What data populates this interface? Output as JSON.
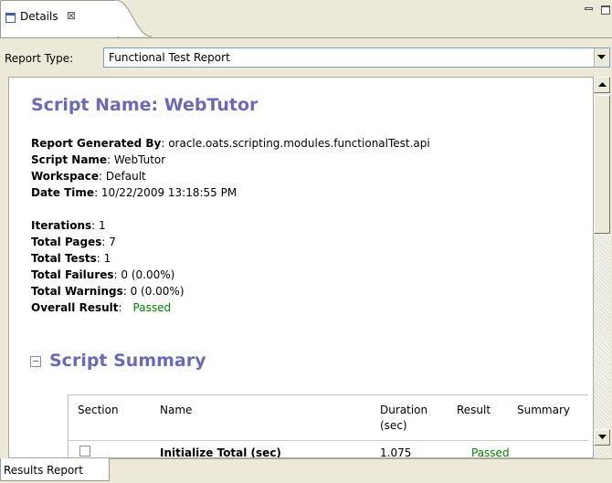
{
  "view_tab": {
    "label": "Details",
    "close_glyph": "⊠",
    "icon": "details-view-icon"
  },
  "window_controls": {
    "minimize": "minimize-icon",
    "maximize": "maximize-icon"
  },
  "report_type": {
    "label": "Report Type:",
    "value": "Functional Test Report"
  },
  "report": {
    "title": "Script Name: WebTutor",
    "generated_by": {
      "label": "Report Generated By",
      "value": ": oracle.oats.scripting.modules.functionalTest.api"
    },
    "script_name": {
      "label": "Script Name",
      "value": ": WebTutor"
    },
    "workspace": {
      "label": "Workspace",
      "value": ": Default"
    },
    "date_time": {
      "label": "Date Time",
      "value": ": 10/22/2009 13:18:55 PM"
    },
    "iterations": {
      "label": "Iterations",
      "value": ": 1"
    },
    "total_pages": {
      "label": "Total Pages",
      "value": ": 7"
    },
    "total_tests": {
      "label": "Total Tests",
      "value": ": 1"
    },
    "total_failures": {
      "label": "Total Failures",
      "value": ": 0 (0.00%)"
    },
    "total_warnings": {
      "label": "Total Warnings",
      "value": ": 0 (0.00%)"
    },
    "overall_result": {
      "label": "Overall Result",
      "colon": ":",
      "value": "Passed"
    },
    "summary_heading": "Script Summary",
    "table": {
      "headers": {
        "section": "Section",
        "name": "Name",
        "duration": "Duration\n(sec)",
        "result": "Result",
        "summary": "Summary"
      },
      "rows": [
        {
          "name": "Initialize Total (sec)",
          "duration": "1.075",
          "result": "Passed"
        }
      ]
    }
  },
  "bottom_tab": {
    "label": "Results Report"
  },
  "colors": {
    "heading": "#6a6ab6",
    "passed": "#008000",
    "chrome": "#ece9d8"
  }
}
